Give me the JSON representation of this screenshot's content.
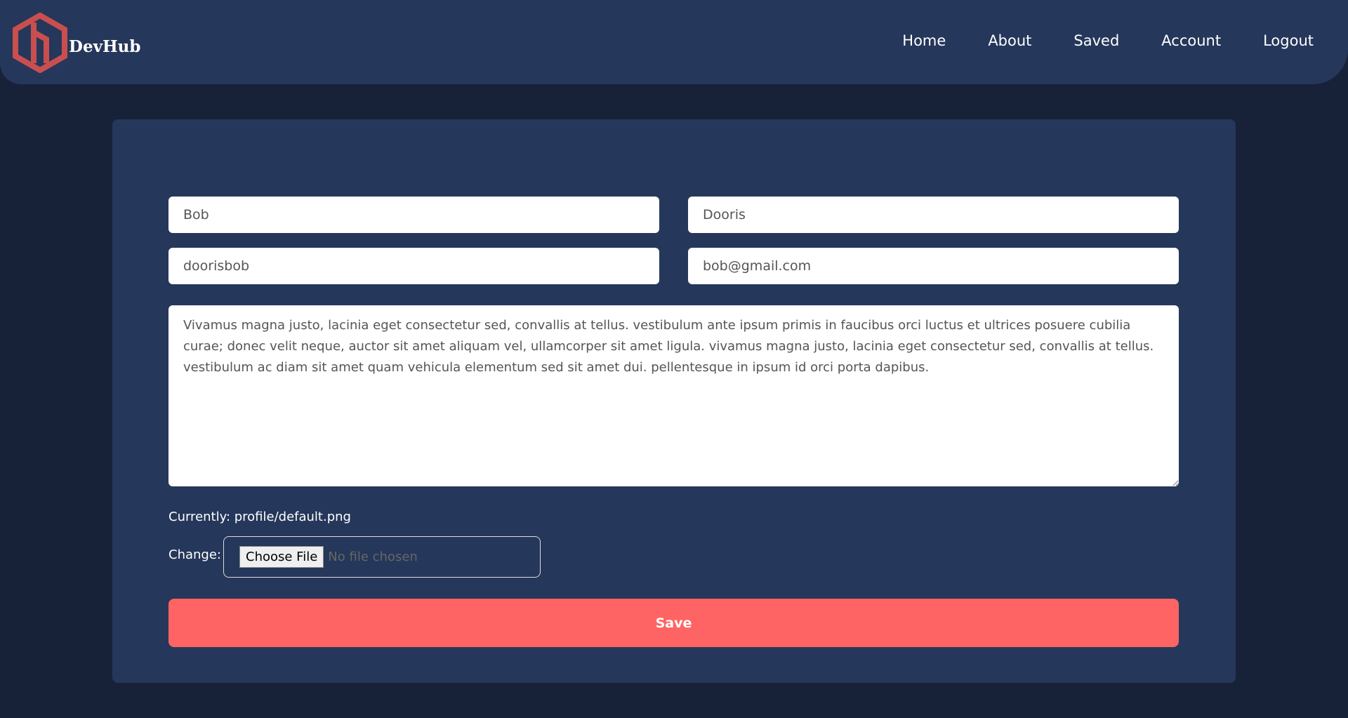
{
  "brand": {
    "name": "DevHub",
    "logo_color": "#c94f4f"
  },
  "nav": [
    {
      "label": "Home"
    },
    {
      "label": "About"
    },
    {
      "label": "Saved"
    },
    {
      "label": "Account"
    },
    {
      "label": "Logout"
    }
  ],
  "form": {
    "first_name": "Bob",
    "last_name": "Dooris",
    "username": "doorisbob",
    "email": "bob@gmail.com",
    "bio": "Vivamus magna justo, lacinia eget consectetur sed, convallis at tellus. vestibulum ante ipsum primis in faucibus orci luctus et ultrices posuere cubilia curae; donec velit neque, auctor sit amet aliquam vel, ullamcorper sit amet ligula. vivamus magna justo, lacinia eget consectetur sed, convallis at tellus. vestibulum ac diam sit amet quam vehicula elementum sed sit amet dui. pellentesque in ipsum id orci porta dapibus.",
    "currently": "Currently: profile/default.png",
    "change_label": "Change:",
    "choose_file": "Choose File",
    "no_file": "No file chosen",
    "save": "Save"
  },
  "colors": {
    "background": "#172239",
    "panel": "#25375a",
    "accent": "#ff6464"
  }
}
